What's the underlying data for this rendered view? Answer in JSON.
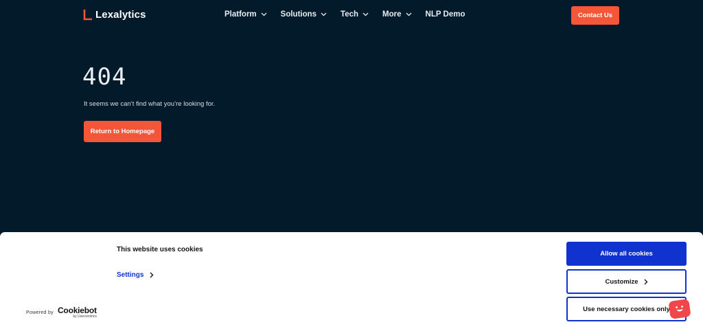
{
  "brand": {
    "name": "Lexalytics",
    "accent": "#f5563a"
  },
  "nav": {
    "items": [
      {
        "label": "Platform",
        "has_dropdown": true
      },
      {
        "label": "Solutions",
        "has_dropdown": true
      },
      {
        "label": "Tech",
        "has_dropdown": true
      },
      {
        "label": "More",
        "has_dropdown": true
      },
      {
        "label": "NLP Demo",
        "has_dropdown": false
      }
    ],
    "contact_label": "Contact Us"
  },
  "error": {
    "code": "404",
    "message": "It seems we can’t find what you’re looking for.",
    "home_button": "Return to Homepage"
  },
  "cookie_banner": {
    "title": "This website uses cookies",
    "settings_label": "Settings",
    "powered_by": "Powered by",
    "provider_name": "Cookiebot",
    "provider_sub": "by Usercentrics",
    "allow_all": "Allow all cookies",
    "customize": "Customize",
    "necessary_only": "Use necessary cookies only",
    "primary_color": "#1032cf"
  },
  "colors": {
    "background": "#031a2b",
    "button": "#f5563a",
    "chat": "#f0484a"
  }
}
